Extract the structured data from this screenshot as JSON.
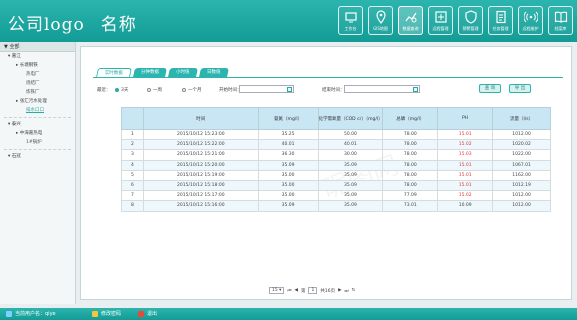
{
  "header": {
    "logo": "公司logo",
    "name": "名称"
  },
  "nav": [
    {
      "label": "工作台",
      "icon": "workbench-icon"
    },
    {
      "label": "GIS地图",
      "icon": "map-pin-icon"
    },
    {
      "label": "数据查询",
      "icon": "data-query-icon",
      "active": true
    },
    {
      "label": "远程管理",
      "icon": "remote-manage-icon"
    },
    {
      "label": "预警管理",
      "icon": "shield-icon"
    },
    {
      "label": "任务管理",
      "icon": "task-icon"
    },
    {
      "label": "远程维护",
      "icon": "signal-icon"
    },
    {
      "label": "档案库",
      "icon": "book-icon"
    }
  ],
  "sidebar": {
    "header": "全部",
    "tree": [
      {
        "label": "嘉江",
        "level": 1
      },
      {
        "label": "长塘钢铁",
        "level": 2
      },
      {
        "label": "热电厂",
        "level": 3
      },
      {
        "label": "烧结厂",
        "level": 3
      },
      {
        "label": "炼铁厂",
        "level": 3
      },
      {
        "label": "张汇污水处理",
        "level": 2
      },
      {
        "label": "排水口口",
        "level": 3,
        "selected": true
      },
      {
        "label": "泰兴",
        "level": 1
      },
      {
        "label": "中海嘉热电",
        "level": 2
      },
      {
        "label": "1#锅炉",
        "level": 3
      },
      {
        "label": "石冠",
        "level": 1
      }
    ]
  },
  "tabs": [
    "实时数据",
    "分钟数据",
    "小时值",
    "日数值"
  ],
  "filters": {
    "recent_label": "最近：",
    "opt1": "3天",
    "opt2": "一周",
    "opt3": "一个月",
    "start_label": "开始时间：",
    "end_label": "结束时间："
  },
  "buttons": {
    "query": "查 询",
    "export": "导 出"
  },
  "table": {
    "headers": [
      "",
      "时间",
      "氨氮（mg/l）",
      "化学需氧量（COD cr）（mg/l）",
      "总磷（mg/l）",
      "PH",
      "流量（l/s）"
    ],
    "rows": [
      [
        "1",
        "2015/10/12 15:23:00",
        "35.25",
        "50.00",
        "78.00",
        "15.01",
        "1012.00"
      ],
      [
        "2",
        "2015/10/12 15:22:00",
        "40.01",
        "40.01",
        "78.00",
        "15.02",
        "1020.02"
      ],
      [
        "3",
        "2015/10/12 15:21:00",
        "36.30",
        "30.00",
        "78.00",
        "15.03",
        "1022.00"
      ],
      [
        "4",
        "2015/10/12 15:20:00",
        "35.09",
        "35.09",
        "78.00",
        "15.01",
        "1067.01"
      ],
      [
        "5",
        "2015/10/12 15:19:00",
        "35.00",
        "35.09",
        "78.00",
        "15.01",
        "1162.00"
      ],
      [
        "6",
        "2015/10/12 15:18:00",
        "35.00",
        "35.09",
        "78.00",
        "15.01",
        "1012.19"
      ],
      [
        "7",
        "2015/10/12 15:17:00",
        "35.00",
        "35.09",
        "77.09",
        "15.02",
        "1012.00"
      ],
      [
        "8",
        "2015/10/12 15:16:00",
        "35.09",
        "35.09",
        "73.01",
        "10.09",
        "1012.00"
      ]
    ]
  },
  "pager": {
    "size": "15",
    "page_prefix": "第",
    "page": "1",
    "page_suffix": "共16页"
  },
  "footer": {
    "user": "当前用户名：qiye",
    "change_pwd": "修改密码",
    "logout": "退出"
  }
}
